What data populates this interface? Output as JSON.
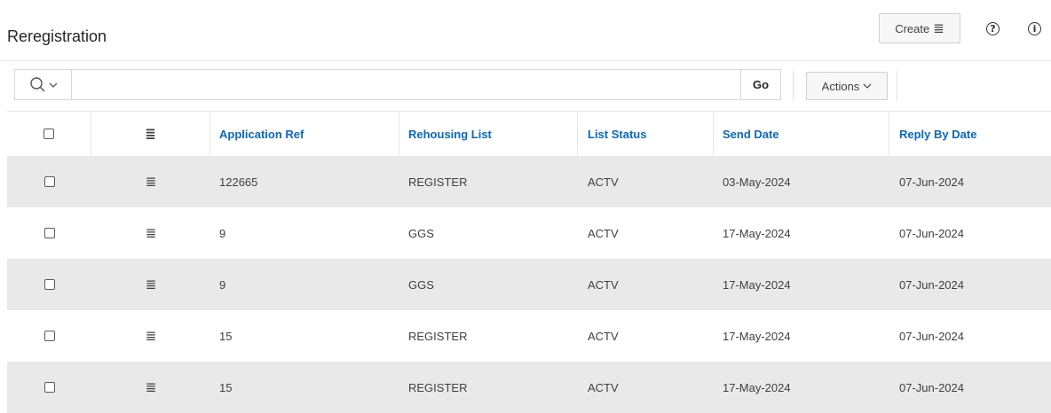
{
  "page": {
    "title": "Reregistration"
  },
  "toolbar": {
    "create_label": "Create",
    "create_icon": "hamburger-menu-icon",
    "help_icon": "help-icon",
    "help_glyph": "?",
    "info_icon": "info-icon",
    "info_glyph": "i"
  },
  "search": {
    "placeholder": "",
    "search_icon": "search-icon",
    "dropdown_icon": "chevron-down-icon",
    "go_label": "Go",
    "actions_label": "Actions"
  },
  "table": {
    "columns": [
      "Application Ref",
      "Rehousing List",
      "List Status",
      "Send Date",
      "Reply By Date"
    ],
    "rows": [
      {
        "app_ref": "122665",
        "rehousing_list": "REGISTER",
        "list_status": "ACTV",
        "send_date": "03-May-2024",
        "reply_by_date": "07-Jun-2024"
      },
      {
        "app_ref": "9",
        "rehousing_list": "GGS",
        "list_status": "ACTV",
        "send_date": "17-May-2024",
        "reply_by_date": "07-Jun-2024"
      },
      {
        "app_ref": "9",
        "rehousing_list": "GGS",
        "list_status": "ACTV",
        "send_date": "17-May-2024",
        "reply_by_date": "07-Jun-2024"
      },
      {
        "app_ref": "15",
        "rehousing_list": "REGISTER",
        "list_status": "ACTV",
        "send_date": "17-May-2024",
        "reply_by_date": "07-Jun-2024"
      },
      {
        "app_ref": "15",
        "rehousing_list": "REGISTER",
        "list_status": "ACTV",
        "send_date": "17-May-2024",
        "reply_by_date": "07-Jun-2024"
      }
    ]
  },
  "colors": {
    "header_link": "#056ac8",
    "row_shade": "#e9e9e9",
    "border": "#e6e6e6"
  }
}
